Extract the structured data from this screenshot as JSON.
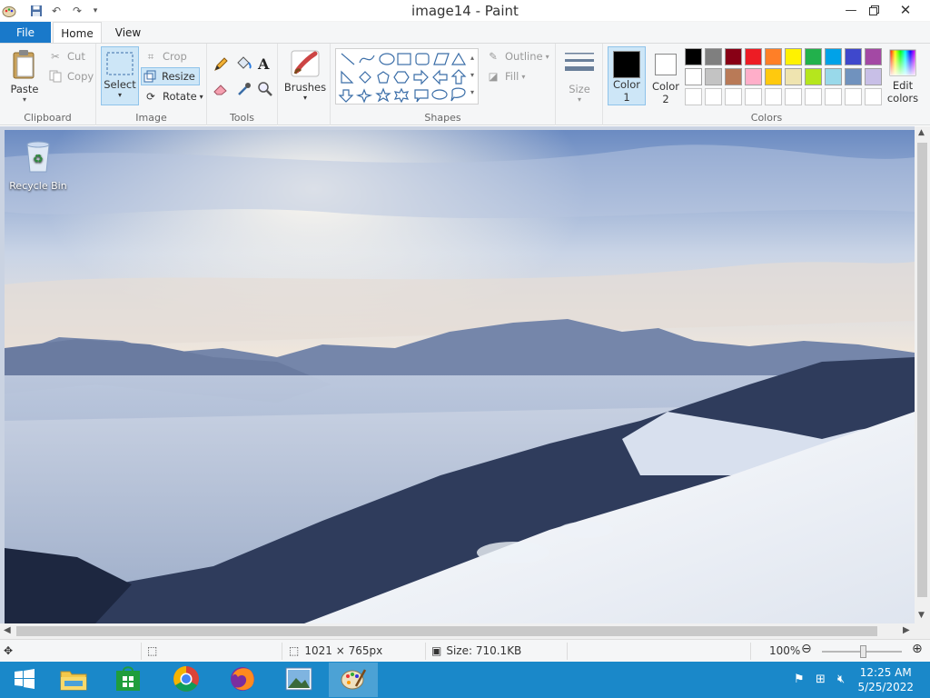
{
  "window": {
    "title": "image14 - Paint"
  },
  "tabs": {
    "file": "File",
    "home": "Home",
    "view": "View"
  },
  "clipboard": {
    "paste": "Paste",
    "cut": "Cut",
    "copy": "Copy",
    "label": "Clipboard"
  },
  "image": {
    "select": "Select",
    "crop": "Crop",
    "resize": "Resize",
    "rotate": "Rotate",
    "label": "Image"
  },
  "tools": {
    "label": "Tools"
  },
  "brushes": {
    "label": "Brushes"
  },
  "shapes": {
    "outline": "Outline",
    "fill": "Fill",
    "label": "Shapes"
  },
  "size": {
    "label": "Size"
  },
  "colors": {
    "color1": "Color\n1",
    "color1_line1": "Color",
    "color1_line2": "1",
    "color2_line1": "Color",
    "color2_line2": "2",
    "edit_line1": "Edit",
    "edit_line2": "colors",
    "label": "Colors",
    "color1_value": "#000000",
    "color2_value": "#ffffff",
    "palette_row1": [
      "#000000",
      "#7f7f7f",
      "#880015",
      "#ed1c24",
      "#ff7f27",
      "#fff200",
      "#22b14c",
      "#00a2e8",
      "#3f48cc",
      "#a349a4"
    ],
    "palette_row2": [
      "#ffffff",
      "#c3c3c3",
      "#b97a57",
      "#ffaec9",
      "#ffc90e",
      "#efe4b0",
      "#b5e61d",
      "#99d9ea",
      "#7092be",
      "#c8bfe7"
    ]
  },
  "desktop": {
    "recycle_bin": "Recycle Bin"
  },
  "status": {
    "dimensions": "1021 × 765px",
    "size": "Size: 710.1KB",
    "zoom": "100%"
  },
  "taskbar": {
    "time": "12:25 AM",
    "date": "5/25/2022"
  }
}
